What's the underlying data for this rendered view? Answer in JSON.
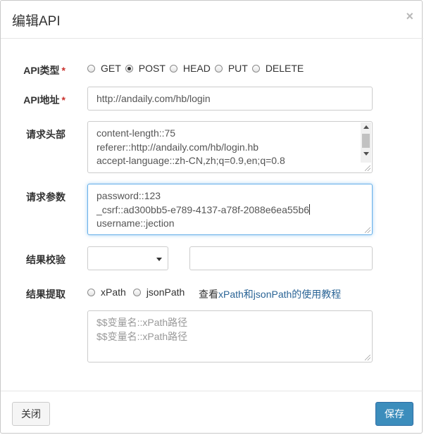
{
  "modal": {
    "title": "编辑API",
    "close_glyph": "×"
  },
  "form": {
    "api_type": {
      "label": "API类型",
      "required_mark": "*",
      "options": [
        "GET",
        "POST",
        "HEAD",
        "PUT",
        "DELETE"
      ],
      "selected": "POST"
    },
    "api_url": {
      "label": "API地址",
      "required_mark": "*",
      "value": "http://andaily.com/hb/login"
    },
    "request_headers": {
      "label": "请求头部",
      "lines": [
        "content-length::75",
        "referer::http://andaily.com/hb/login.hb",
        "accept-language::zh-CN,zh;q=0.9,en;q=0.8"
      ]
    },
    "request_params": {
      "label": "请求参数",
      "lines": [
        "password::123",
        "_csrf::ad300bb5-e789-4137-a78f-2088e6ea55b6",
        "username::jection"
      ]
    },
    "result_check": {
      "label": "结果校验",
      "select_value": "",
      "input_value": ""
    },
    "result_extract": {
      "label": "结果提取",
      "options": [
        "xPath",
        "jsonPath"
      ],
      "selected": null,
      "help_prefix": "查看",
      "help_link": "xPath和jsonPath的使用教程",
      "placeholder_lines": [
        "$$变量名::xPath路径",
        "$$变量名::xPath路径"
      ]
    }
  },
  "footer": {
    "close_label": "关闭",
    "save_label": "保存"
  },
  "colors": {
    "primary": "#3c8dbc",
    "required": "#c9302c",
    "link": "#2a6496"
  }
}
